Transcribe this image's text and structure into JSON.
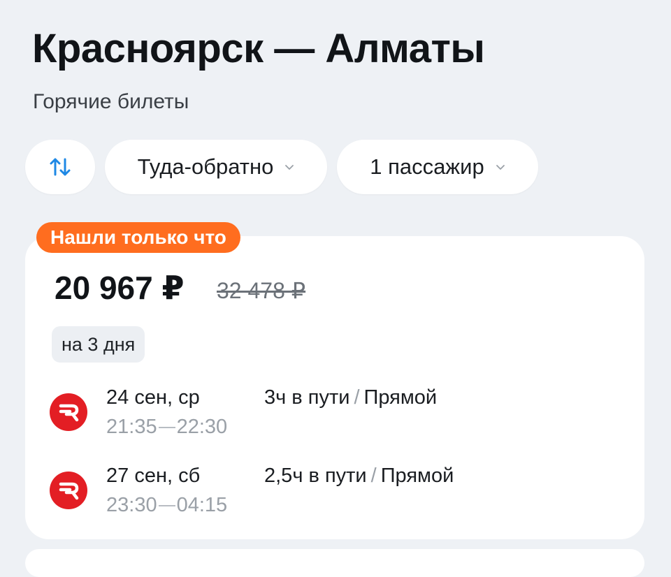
{
  "header": {
    "title": "Красноярск — Алматы",
    "subtitle": "Горячие билеты"
  },
  "filters": {
    "swap_icon": "swap-vertical-arrows-icon",
    "trip_type": "Туда-обратно",
    "passengers": "1 пассажир"
  },
  "offer": {
    "badge": "Нашли только что",
    "price": "20 967 ₽",
    "old_price": "32 478 ₽",
    "duration_days": "на 3 дня",
    "airline_logo_color": "#e31e24",
    "flights": [
      {
        "date": "24 сен, ср",
        "depart": "21:35",
        "arrive": "22:30",
        "travel_time": "3ч в пути",
        "separator": "/",
        "type": "Прямой"
      },
      {
        "date": "27 сен, сб",
        "depart": "23:30",
        "arrive": "04:15",
        "travel_time": "2,5ч в пути",
        "separator": "/",
        "type": "Прямой"
      }
    ]
  },
  "colors": {
    "background": "#eef1f5",
    "badge": "#ff6d1f",
    "accent_blue": "#1e88e5"
  }
}
